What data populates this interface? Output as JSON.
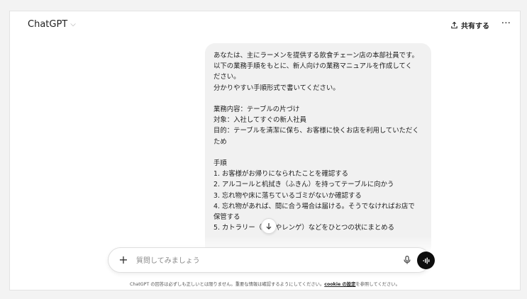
{
  "header": {
    "model_name": "ChatGPT",
    "model_chevron": "⌵",
    "share_label": "共有する",
    "more_label": "···"
  },
  "conversation": {
    "user_message": {
      "p1": "あなたは、主にラーメンを提供する飲食チェーン店の本部社員です。",
      "p2": "以下の業務手順をもとに、新人向けの業務マニュアルを作成してく",
      "p3": "ださい。",
      "p4": "分かりやすい手順形式で書いてください。",
      "p5": "業務内容：テーブルの片づけ",
      "p6": "対象：入社してすぐの新人社員",
      "p7": "目的：テーブルを清潔に保ち、お客様に快くお店を利用していただく",
      "p8": "ため",
      "p9": "手順",
      "s1": "1. お客様がお帰りになられたことを確認する",
      "s2": "2. アルコールと机拭き（ふきん）を持ってテーブルに向かう",
      "s3": "3. 忘れ物や床に落ちているゴミがないか確認する",
      "s4": "4. 忘れ物があれば、間に合う場合は届ける。そうでなければお店で",
      "s5": "保管する",
      "s6": "5. カトラリー（お箸やレンゲ）などをひとつの状にまとめる"
    }
  },
  "composer": {
    "plus_label": "+",
    "placeholder": "質問してみましょう"
  },
  "footer": {
    "disclaimer_before": "ChatGPT の回答は必ずしも正しいとは限りません。重要な情報は確認するようにしてください。",
    "cookie_link": "cookie の設定",
    "disclaimer_after": "を参照してください。"
  },
  "colors": {
    "bubble": "#f1f1f1",
    "voice_button": "#0d0d0d",
    "page_background": "#f3f3f3"
  },
  "icons": {
    "share": "share-upload-icon",
    "scroll": "arrow-down-icon",
    "mic": "microphone-icon",
    "voice": "voice-waveform-icon"
  }
}
